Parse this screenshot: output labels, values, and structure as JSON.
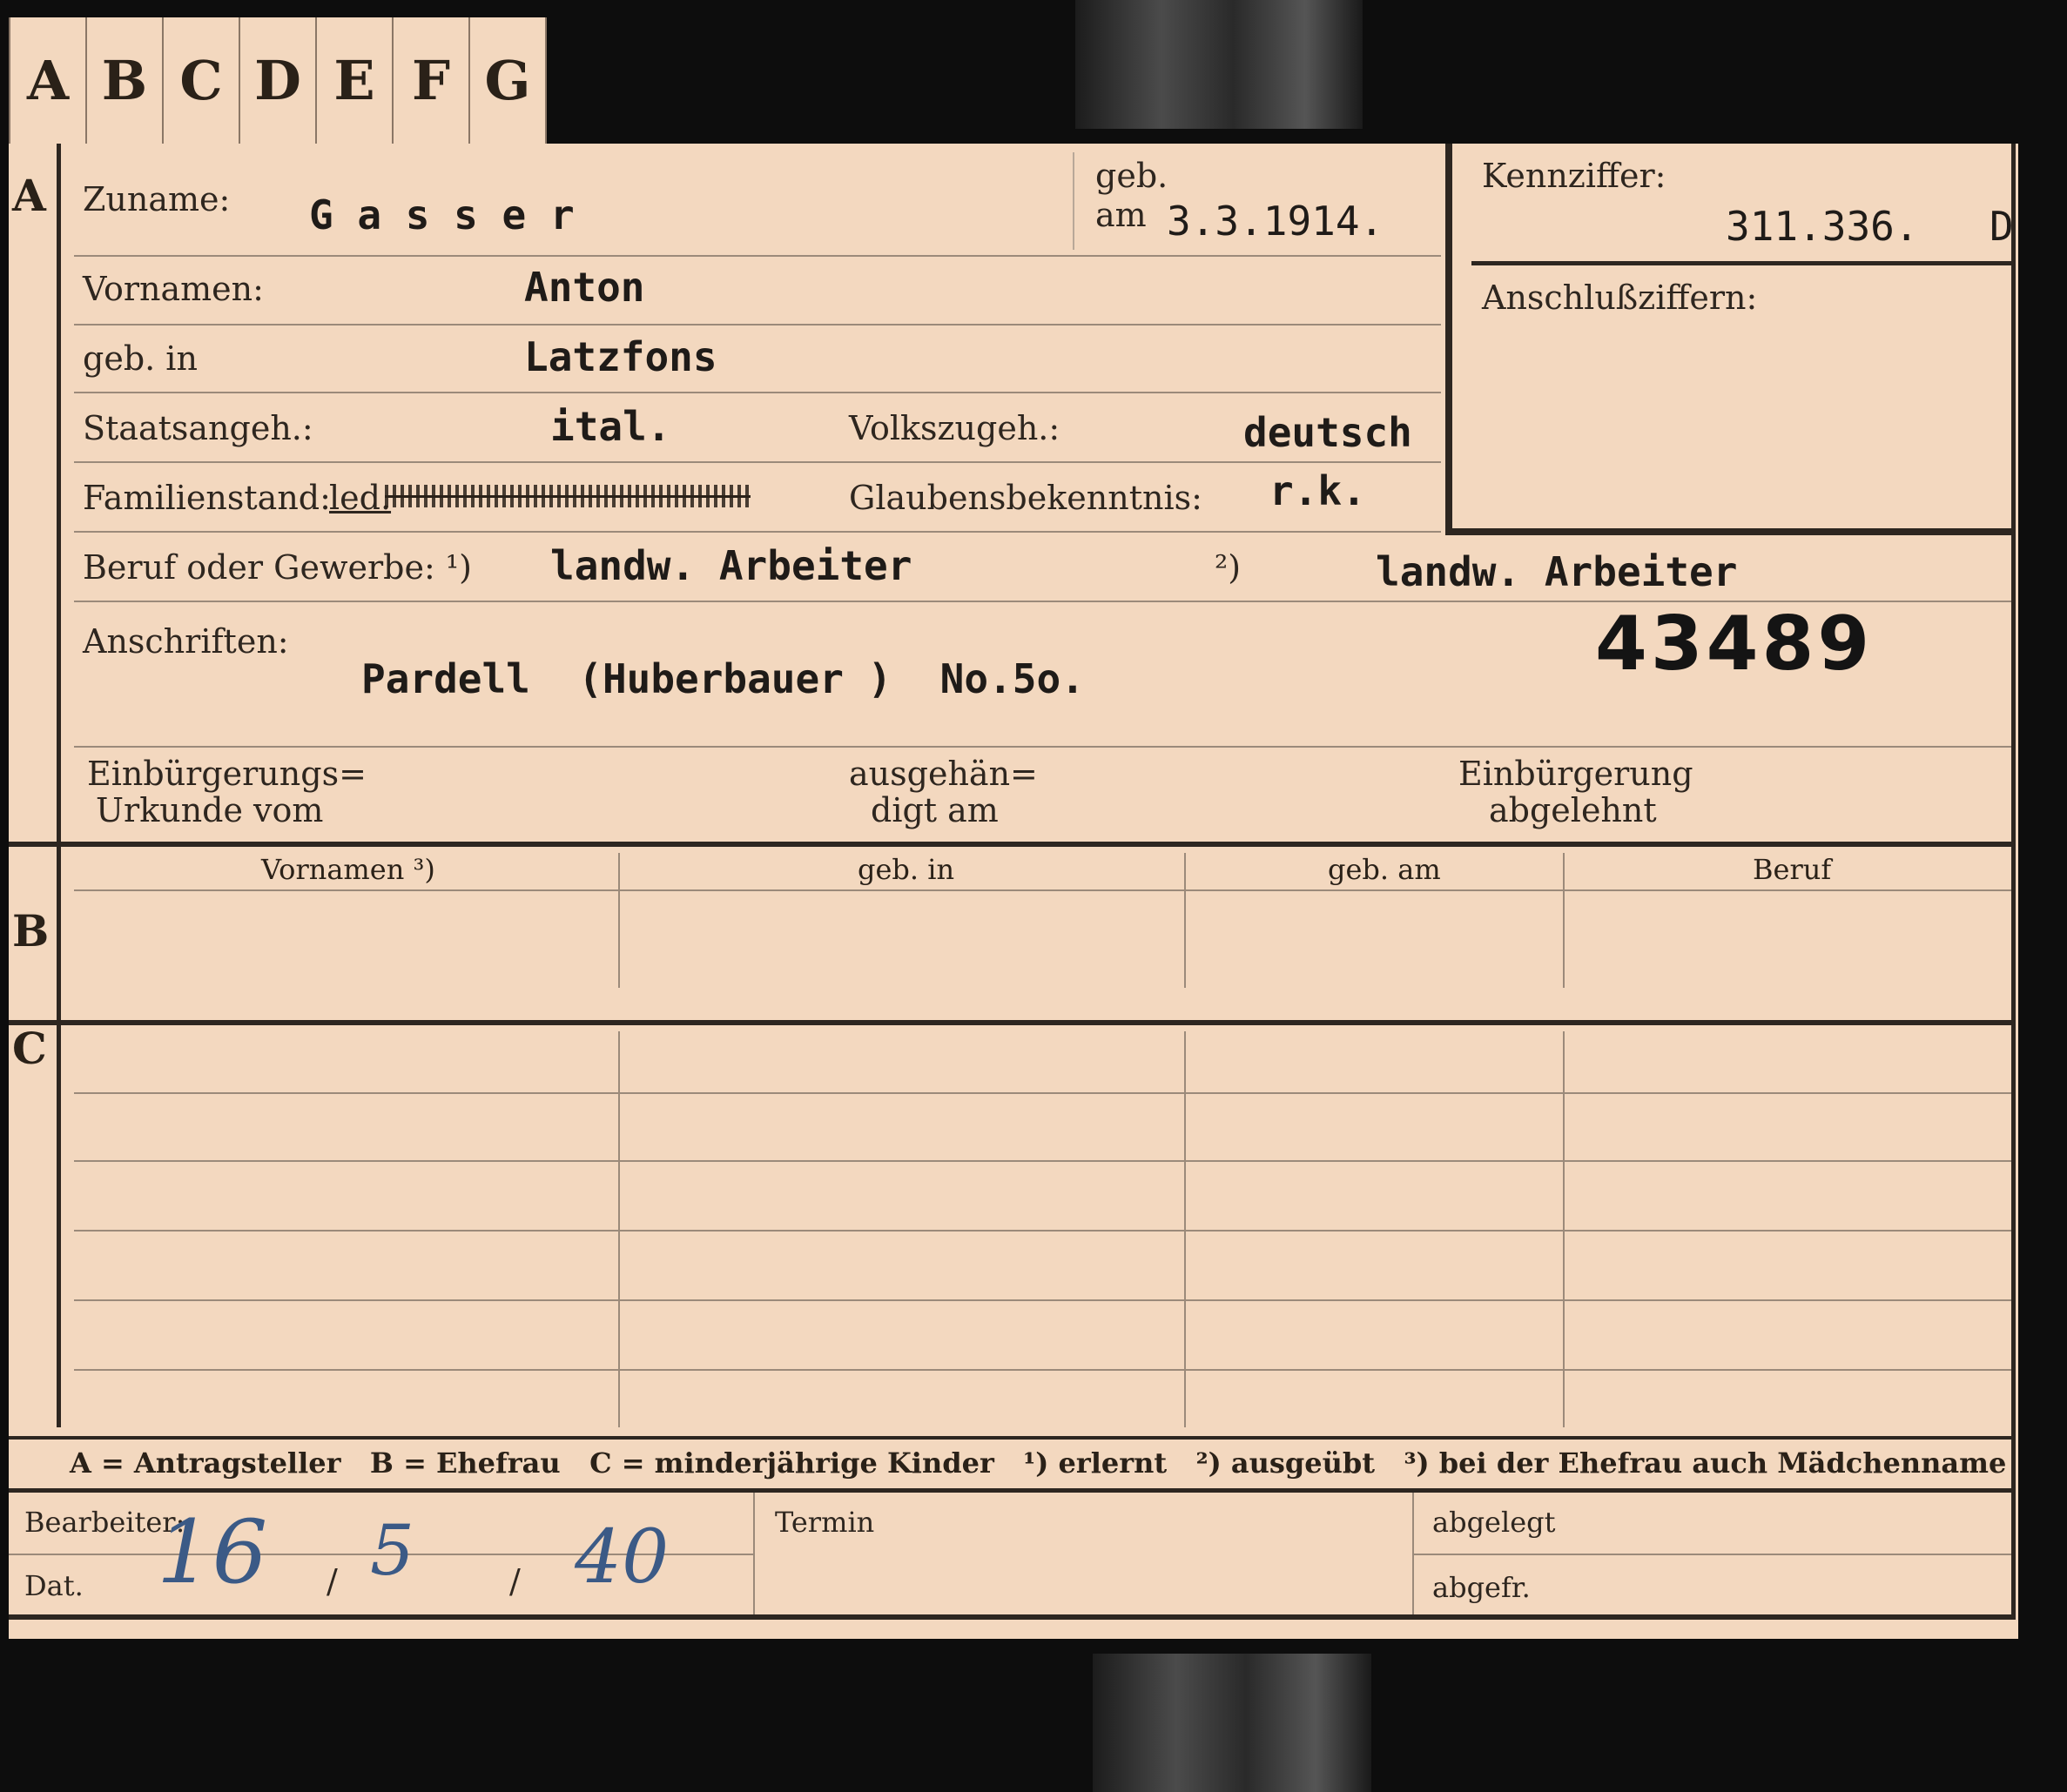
{
  "tabs": [
    "A",
    "B",
    "C",
    "D",
    "E",
    "F",
    "G"
  ],
  "section_letters": {
    "a": "A",
    "b": "B",
    "c": "C"
  },
  "labels": {
    "zuname": "Zuname:",
    "geb": "geb.",
    "am": "am",
    "kennziffer": "Kennziffer:",
    "anschlussziffern": "Anschlußziffern:",
    "vornamen": "Vornamen:",
    "geb_in": "geb. in",
    "staatsangeh": "Staatsangeh.:",
    "volkszugeh": "Volkszugeh.:",
    "familienstand": "Familienstand:",
    "glaubensbekenntnis": "Glaubensbekenntnis:",
    "beruf_oder_gewerbe": "Beruf oder Gewerbe: ¹)",
    "beruf_marker2": "²)",
    "anschriften": "Anschriften:",
    "einbuergerungsurkunde_1": "Einbürgerungs=",
    "einbuergerungsurkunde_2": "Urkunde vom",
    "ausgehaendigt_1": "ausgehän=",
    "ausgehaendigt_2": "digt am",
    "einbuergerung_abgelehnt_1": "Einbürgerung",
    "einbuergerung_abgelehnt_2": "abgelehnt",
    "bearbeiter": "Bearbeiter:",
    "dat": "Dat.",
    "termin": "Termin",
    "abgelegt": "abgelegt",
    "abgefr": "abgefr."
  },
  "values": {
    "zuname": "G a s s e r",
    "geb_am": "3.3.1914.",
    "kennziffer": "311.336.",
    "kennziffer_suffix": "D",
    "vornamen": "Anton",
    "geb_in": "Latzfons",
    "staatsangeh": "ital.",
    "volkszugeh": "deutsch",
    "familienstand": "led.",
    "glaubensbekenntnis": "r.k.",
    "beruf_1": "landw. Arbeiter",
    "beruf_2": "landw. Arbeiter",
    "anschrift": "Pardell  (Huberbauer )  No.5o.",
    "stamp_number": "43489"
  },
  "section_b_headers": [
    "Vornamen ³)",
    "geb. in",
    "geb. am",
    "Beruf"
  ],
  "legend": "A = Antragsteller   B = Ehefrau   C = minderjährige Kinder   ¹) erlernt   ²) ausgeübt   ³) bei der Ehefrau auch Mädchenname",
  "handwritten_date": {
    "day": "16",
    "month": "5",
    "year": "40"
  }
}
